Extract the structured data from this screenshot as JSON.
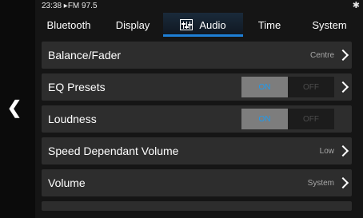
{
  "status": {
    "time_radio": "23:38 ▸FM 97.5"
  },
  "tabs": [
    {
      "label": "Bluetooth"
    },
    {
      "label": "Display"
    },
    {
      "label": "Audio"
    },
    {
      "label": "Time"
    },
    {
      "label": "System"
    }
  ],
  "rows": [
    {
      "label": "Balance/Fader",
      "value": "Centre"
    },
    {
      "label": "EQ Presets",
      "toggle": {
        "on": "ON",
        "off": "OFF",
        "state": "on"
      }
    },
    {
      "label": "Loudness",
      "toggle": {
        "on": "ON",
        "off": "OFF",
        "state": "on"
      }
    },
    {
      "label": "Speed Dependant Volume",
      "value": "Low"
    },
    {
      "label": "Volume",
      "value": "System"
    }
  ],
  "colors": {
    "accent": "#1e7fd6",
    "row_bg": "#2d2d2d",
    "toggle_on": "#7d7d7d"
  }
}
